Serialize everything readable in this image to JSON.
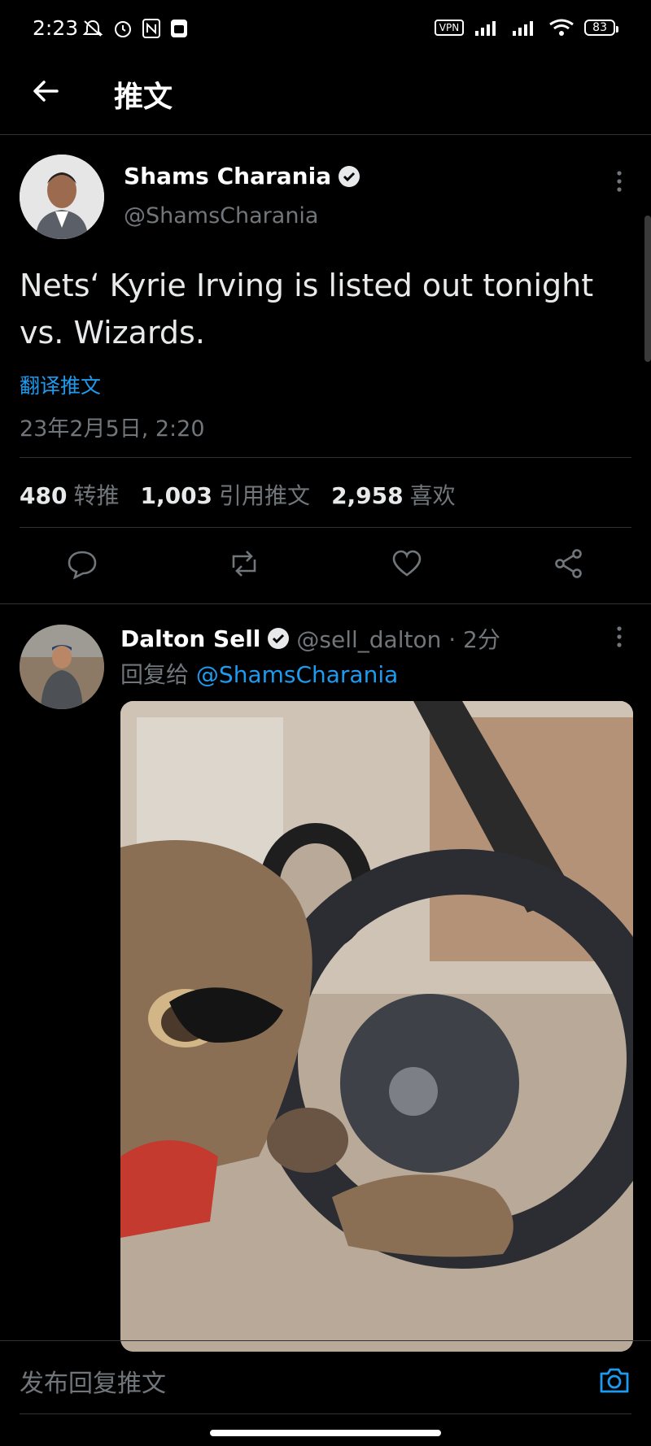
{
  "status_bar": {
    "time": "2:23",
    "vpn_label": "VPN",
    "battery": "83"
  },
  "header": {
    "title": "推文"
  },
  "main_tweet": {
    "author_name": "Shams Charania",
    "author_handle": "@ShamsCharania",
    "text": "Nets‘ Kyrie Irving is listed out tonight vs. Wizards.",
    "translate_label": "翻译推文",
    "timestamp": "23年2月5日, 2:20",
    "stats": {
      "retweets_count": "480",
      "retweets_label": "转推",
      "quotes_count": "1,003",
      "quotes_label": "引用推文",
      "likes_count": "2,958",
      "likes_label": "喜欢"
    }
  },
  "reply_tweet": {
    "author_name": "Dalton Sell",
    "author_handle_time": "@sell_dalton · 2分",
    "reply_prefix": "回复给",
    "reply_to_handle": "@ShamsCharania"
  },
  "composer": {
    "placeholder": "发布回复推文"
  },
  "colors": {
    "accent": "#1d9bf0",
    "muted": "#71767b",
    "background": "#000000"
  }
}
